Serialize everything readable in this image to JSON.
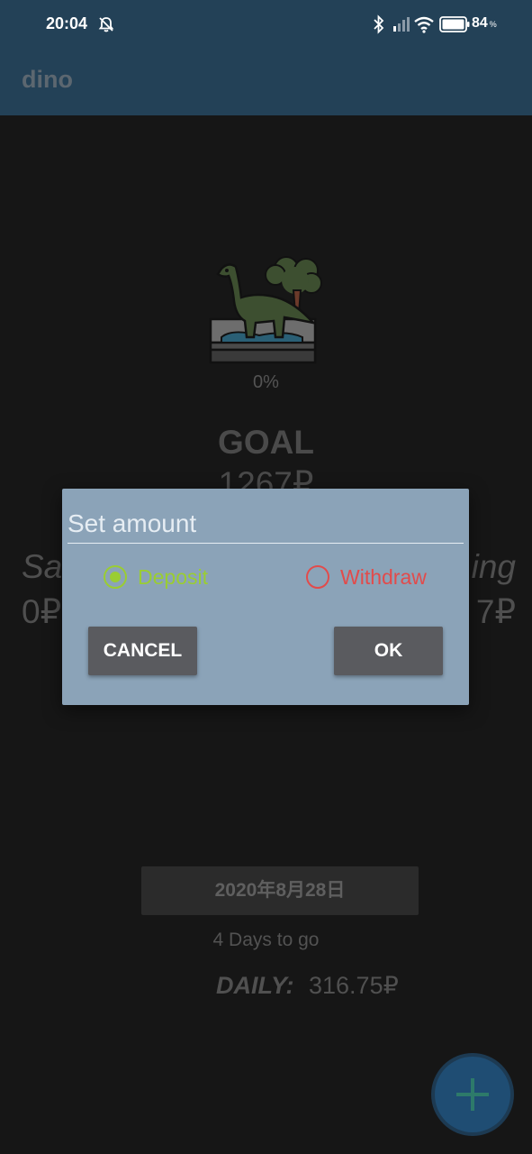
{
  "status_bar": {
    "time": "20:04",
    "battery_percent": "84",
    "battery_unit": "%"
  },
  "app_bar": {
    "title": "dino"
  },
  "main": {
    "progress": "0%",
    "goal_label": "GOAL",
    "goal_amount": "1267₽",
    "saved_label": "Sa",
    "saved_value": "0₽",
    "remaining_label": "ing",
    "remaining_value": "7₽",
    "date": "2020年8月28日",
    "days_to_go": "4 Days to go",
    "daily_label": "DAILY:",
    "daily_value": "316.75₽"
  },
  "dialog": {
    "amount_placeholder": "Set amount",
    "amount_value": "",
    "deposit_label": "Deposit",
    "withdraw_label": "Withdraw",
    "selected_option": "Deposit",
    "cancel_label": "CANCEL",
    "ok_label": "OK"
  },
  "icons": {
    "status": [
      "bell-off-icon",
      "bluetooth-icon",
      "signal-icon",
      "wifi-icon",
      "battery-icon"
    ],
    "fab": "plus-icon",
    "illustration": "dinosaur-icon"
  },
  "colors": {
    "app_bar": "#234157",
    "background": "#161616",
    "dialog": "#8ba3b8",
    "deposit": "#9acd32",
    "withdraw": "#e24b4b",
    "fab": "#1f4d73"
  }
}
